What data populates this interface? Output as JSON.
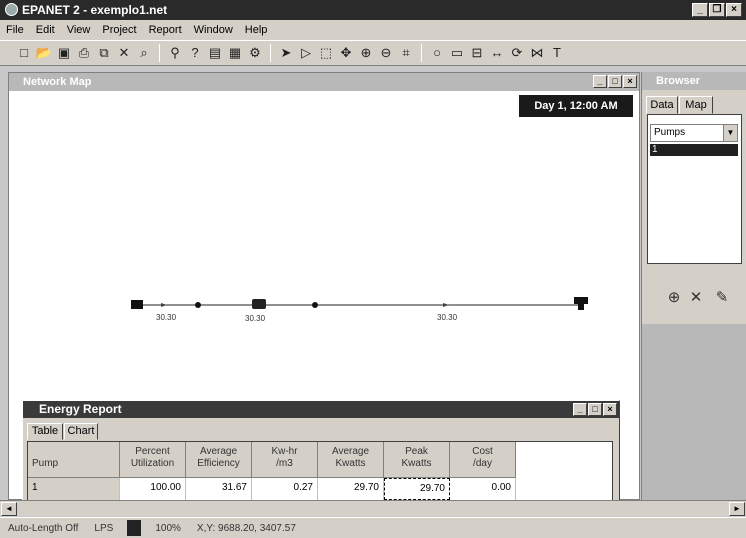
{
  "window": {
    "title": "EPANET 2 - exemplo1.net"
  },
  "menu": [
    "File",
    "Edit",
    "View",
    "Project",
    "Report",
    "Window",
    "Help"
  ],
  "toolbar": {
    "groups": [
      [
        "new-icon",
        "open-icon",
        "save-icon",
        "print-icon",
        "copy-icon",
        "delete-icon",
        "find-icon"
      ],
      [
        "run-icon",
        "query-icon",
        "graph-icon",
        "table-icon",
        "options-icon"
      ],
      [
        "select-object-icon",
        "select-vertex-icon",
        "select-region-icon",
        "pan-icon",
        "zoom-in-icon",
        "zoom-out-icon",
        "full-extent-icon"
      ],
      [
        "junction-icon",
        "reservoir-icon",
        "tank-icon",
        "pipe-icon",
        "pump-icon",
        "valve-icon",
        "label-icon"
      ]
    ]
  },
  "network_map": {
    "title": "Network Map",
    "time_badge": "Day 1, 12:00 AM",
    "link_labels": [
      "30.30",
      "30.30",
      "30.30"
    ]
  },
  "browser": {
    "title": "Browser",
    "tabs": [
      "Data",
      "Map"
    ],
    "category": "Pumps",
    "selected_item": "1"
  },
  "energy_report": {
    "title": "Energy Report",
    "tabs": [
      "Table",
      "Chart"
    ],
    "columns": [
      [
        "Pump"
      ],
      [
        "Percent",
        "Utilization"
      ],
      [
        "Average",
        "Efficiency"
      ],
      [
        "Kw-hr",
        "/m3"
      ],
      [
        "Average",
        "Kwatts"
      ],
      [
        "Peak",
        "Kwatts"
      ],
      [
        "Cost",
        "/day"
      ]
    ],
    "row": [
      "1",
      "100.00",
      "31.67",
      "0.27",
      "29.70",
      "29.70",
      "0.00"
    ]
  },
  "status": {
    "auto_length": "Auto-Length Off",
    "units": "LPS",
    "zoom": "100%",
    "coords": "X,Y: 9688.20, 3407.57"
  }
}
